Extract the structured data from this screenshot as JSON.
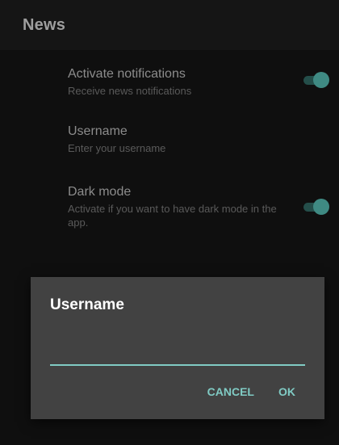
{
  "appbar": {
    "title": "News"
  },
  "preferences": {
    "items": [
      {
        "title": "Activate notifications",
        "summary": "Receive news notifications",
        "type": "switch",
        "checked": true
      },
      {
        "title": "Username",
        "summary": "Enter your username",
        "type": "edit-text"
      },
      {
        "title": "Dark mode",
        "summary": "Activate if you want to have dark mode in the app.",
        "type": "switch",
        "checked": true
      }
    ]
  },
  "dialog": {
    "title": "Username",
    "input_value": "",
    "cancel_label": "CANCEL",
    "ok_label": "OK"
  },
  "colors": {
    "accent": "#80cbc4",
    "dialog_background": "#424242",
    "app_background": "#0f0f0f"
  }
}
